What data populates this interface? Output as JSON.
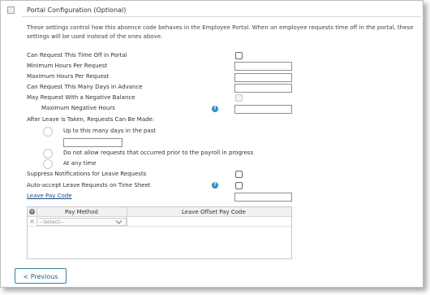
{
  "section": {
    "title": "Portal Configuration (Optional)",
    "description_line1": "These settings control how this absence code behaves in the Employee Portal. When an employee requests time off in the portal, these",
    "description_line2": "settings will be used instead of the ones above."
  },
  "fields": {
    "can_request": "Can Request This Time Off in Portal",
    "min_hours": "Minimum Hours Per Request",
    "max_hours": "Maximum Hours Per Request",
    "days_advance": "Can Request This Many Days in Advance",
    "negative_balance": "May Request With a Negative Balance",
    "max_negative": "Maximum Negative Hours",
    "after_leave": "After Leave is Taken, Requests Can Be Made:",
    "opt_up_to": "Up to this many days in the past",
    "opt_no_prior": "Do not allow requests that occurred prior to the payroll in progress",
    "opt_any": "At any time",
    "suppress": "Suppress Notifications for Leave Requests",
    "auto_accept": "Auto-accept Leave Requests on Time Sheet",
    "leave_pay_code": "Leave Pay Code"
  },
  "help_icon_glyph": "?",
  "grid": {
    "col_pay_method": "Pay Method",
    "col_offset": "Leave Offset Pay Code",
    "select_placeholder": "--Select--",
    "row_delete_glyph": "×",
    "add_glyph": "+"
  },
  "buttons": {
    "previous": "< Previous"
  },
  "colors": {
    "help_icon": "#2a8fc7",
    "link": "#1a4a80",
    "button_border": "#3a7ea0"
  }
}
